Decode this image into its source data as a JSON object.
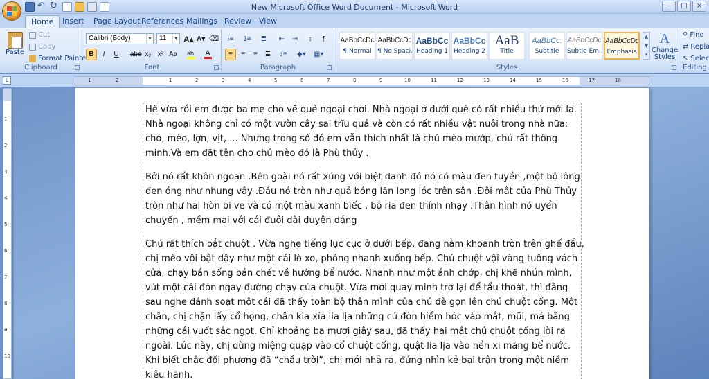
{
  "window": {
    "title": "New Microsoft Office Word Document - Microsoft Word",
    "controls": [
      "–",
      "□",
      "×"
    ]
  },
  "quick_access": [
    "save-icon",
    "undo-icon",
    "redo-icon",
    "new-icon",
    "open-icon",
    "print-icon",
    "check-icon"
  ],
  "tabs": [
    {
      "label": "Home",
      "active": true
    },
    {
      "label": "Insert"
    },
    {
      "label": "Page Layout"
    },
    {
      "label": "References"
    },
    {
      "label": "Mailings"
    },
    {
      "label": "Review"
    },
    {
      "label": "View"
    }
  ],
  "clipboard": {
    "paste": "Paste",
    "cut": "Cut",
    "copy": "Copy",
    "format_painter": "Format Painter",
    "label": "Clipboard"
  },
  "font": {
    "family": "Calibri (Body)",
    "size": "11",
    "label": "Font",
    "buttons": [
      "B",
      "I",
      "U",
      "abe",
      "x₂",
      "x²",
      "Aa"
    ],
    "grow": "A",
    "shrink": "A",
    "clear": "⌫"
  },
  "paragraph": {
    "label": "Paragraph"
  },
  "styles": {
    "label": "Styles",
    "items": [
      {
        "sample": "AaBbCcDc",
        "name": "¶ Normal"
      },
      {
        "sample": "AaBbCcDc",
        "name": "¶ No Spaci..."
      },
      {
        "sample": "AaBbCc",
        "name": "Heading 1"
      },
      {
        "sample": "AaBbCc",
        "name": "Heading 2"
      },
      {
        "sample": "AaB",
        "name": "Title"
      },
      {
        "sample": "AaBbCc.",
        "name": "Subtitle"
      },
      {
        "sample": "AaBbCcDc",
        "name": "Subtle Em..."
      },
      {
        "sample": "AaBbCcDc",
        "name": "Emphasis"
      }
    ],
    "change_styles": "Change Styles"
  },
  "editing": {
    "find": "Find",
    "replace": "Repla",
    "select": "Select",
    "label": "Editing"
  },
  "ruler": {
    "corner": "L",
    "h_numbers": [
      "1",
      "2",
      "1",
      "2",
      "3",
      "4",
      "5",
      "6",
      "7",
      "8",
      "9",
      "10",
      "11",
      "12",
      "13",
      "14",
      "15",
      "16",
      "17",
      "18"
    ],
    "v_numbers": [
      "1",
      "2",
      "3",
      "4",
      "5",
      "6",
      "7",
      "8",
      "9",
      "10"
    ]
  },
  "document": {
    "paragraphs": [
      "Hè vừa rồi em được ba mẹ cho về quê ngoại chơi. Nhà ngoại ở dưới quê có rất nhiều thứ mới lạ. Nhà ngoại không chỉ có một vườn cây sai trĩu quả và còn có rất nhiều vật nuôi trong nhà nữa: chó, mèo, lợn, vịt, ...  Nhưng trong số đó em vẫn thích nhất là chú mèo mướp, chú rất thông minh.Và em đặt tên cho chú mèo đó là Phù thủy .",
      "Bởi nó rất khôn ngoan .Bên goài nó rất xứng với biệt danh đó nó có màu đen tuyền ,một bộ lông đen óng như nhung vậy .Đầu nó tròn  như quả bóng lăn long lóc trên sân .Đôi mắt của Phù Thủy tròn như hai hòn bi ve  và có một màu xanh biếc , bộ ria đen thính nhạy .Thân hình nó uyển chuyển , mềm mại với cái đuôi dài duyên dáng",
      "Chú rất thích bắt chuột .  Vừa nghe tiếng lục cục ở dưới bếp, đang nằm khoanh tròn trên ghế đẩu, chị mèo vội bật dậy như một cái lò xo, phóng nhanh xuống bếp. Chú chuột vội vàng tuông vách cửa, chạy bán sống bán chết về hướng bể nước. Nhanh như một ánh chớp, chị khẽ nhún mình, vút một cái đón ngay đường chạy của chuột. Vừa mới quay mình trở lại để tẩu thoát, thì đằng sau nghe đánh soạt một cái đã thấy toàn bộ thân mình của chú đè gọn lên chú chuột cống. Một chân, chị chặn lấy cổ họng, chân kia xỉa lia lịa những cú đòn hiểm hóc vào mắt, mũi, má bằng những cái vuốt sắc ngọt. Chỉ khoảng ba mươi giây sau, đã thấy hai mắt chú chuột cống lòi ra ngoài. Lúc này, chị dùng miệng quặp vào cổ chuột cống, quật lia lịa vào nền xi măng bể nước. Khi biết chắc đối phương đã “chầu trời”, chị mới nhả ra, đứng nhìn kẻ bại trận trong một niềm kiêu hãnh."
    ]
  },
  "colors": {
    "accent": "#15428b",
    "ribbon": "#dbe8f8",
    "highlight": "#fbd88a"
  }
}
